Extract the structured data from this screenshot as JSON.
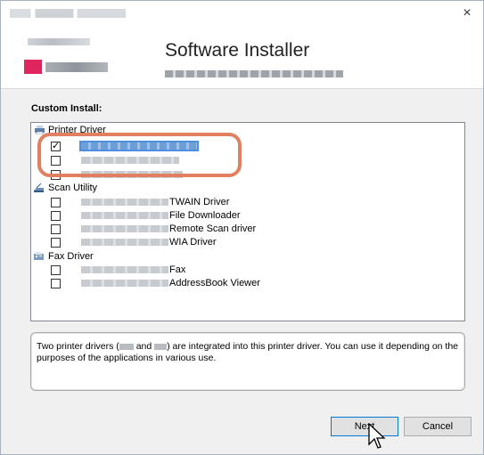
{
  "window": {
    "close_glyph": "×"
  },
  "header": {
    "title": "Software Installer"
  },
  "custom_install": {
    "label": "Custom Install:",
    "groups": [
      {
        "label": "Printer Driver",
        "icon": "printer-icon",
        "items": [
          {
            "suffix": "",
            "checked": true,
            "selected": true
          },
          {
            "suffix": "",
            "checked": false
          },
          {
            "suffix": "",
            "checked": false
          }
        ]
      },
      {
        "label": "Scan Utility",
        "icon": "scanner-icon",
        "items": [
          {
            "suffix": "TWAIN Driver",
            "checked": false
          },
          {
            "suffix": "File Downloader",
            "checked": false
          },
          {
            "suffix": "Remote Scan driver",
            "checked": false
          },
          {
            "suffix": "WIA Driver",
            "checked": false
          }
        ]
      },
      {
        "label": "Fax Driver",
        "icon": "fax-icon",
        "items": [
          {
            "suffix": "Fax",
            "checked": false
          },
          {
            "suffix": "AddressBook Viewer",
            "checked": false
          }
        ]
      }
    ]
  },
  "description": {
    "part1": "Two printer drivers (",
    "part2": " and ",
    "part3": ") are integrated into this printer driver. You can use it depending on the purposes of the applications in various use."
  },
  "buttons": {
    "next": "Next",
    "cancel": "Cancel"
  },
  "colors": {
    "highlight_border": "#e08060",
    "selection": "#4e8fe0",
    "logo_accent": "#e0245e"
  }
}
